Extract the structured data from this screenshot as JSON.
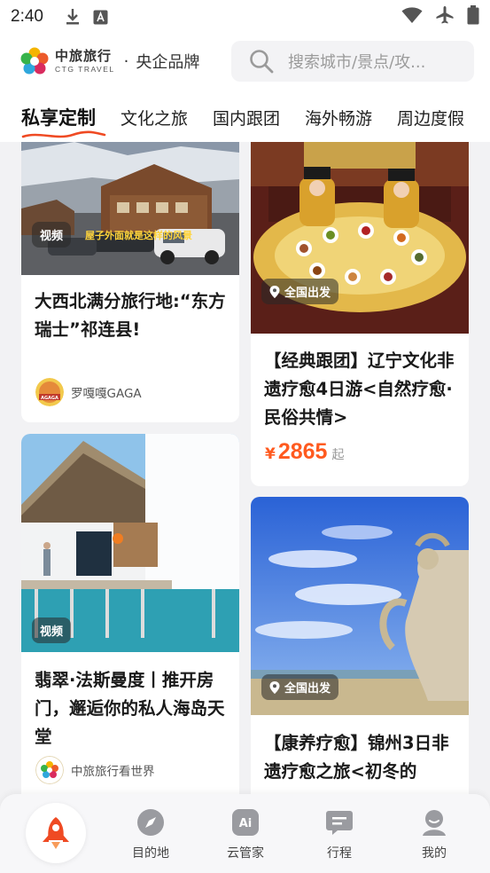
{
  "status_bar": {
    "time": "2:40",
    "icons_left": [
      "download-icon",
      "a-icon"
    ],
    "icons_right": [
      "wifi-icon",
      "airplane-mode-icon",
      "battery-icon"
    ]
  },
  "header": {
    "brand_cn": "中旅旅行",
    "brand_en": "CTG TRAVEL",
    "dot": "·",
    "slogan": "央企品牌",
    "search_placeholder": "搜索城市/景点/攻..."
  },
  "tabs": [
    {
      "label": "私享定制",
      "active": true
    },
    {
      "label": "文化之旅",
      "active": false
    },
    {
      "label": "国内跟团",
      "active": false
    },
    {
      "label": "海外畅游",
      "active": false
    },
    {
      "label": "周边度假",
      "active": false
    }
  ],
  "cards": {
    "left1": {
      "badge": "视频",
      "overlay_caption": "屋子外面就是这样的风景",
      "title": "大西北满分旅行地:“东方瑞士”祁连县!",
      "author": "罗嘎嘎GAGA",
      "avatar_text": "AGAGA"
    },
    "left2": {
      "badge": "视频",
      "title": "翡翠·法斯曼度丨推开房门，邂逅你的私人海岛天堂",
      "author": "中旅旅行看世界"
    },
    "right1": {
      "location": "全国出发",
      "title": "【经典跟团】辽宁文化非遗疗愈4日游<自然疗愈·民俗共情>",
      "price_symbol": "¥",
      "price": "2865",
      "price_suffix": "起"
    },
    "right2": {
      "location": "全国出发",
      "title": "【康养疗愈】锦州3日非遗疗愈之旅<初冬的"
    }
  },
  "bottom_nav": [
    {
      "label": "",
      "icon": "rocket-icon",
      "active": true
    },
    {
      "label": "目的地",
      "icon": "compass-icon"
    },
    {
      "label": "云管家",
      "icon": "ai-icon"
    },
    {
      "label": "行程",
      "icon": "itinerary-icon"
    },
    {
      "label": "我的",
      "icon": "profile-icon"
    }
  ],
  "colors": {
    "accent": "#ff5a1f",
    "brand_orange": "#f26b21",
    "page_bg": "#f2f2f4"
  }
}
